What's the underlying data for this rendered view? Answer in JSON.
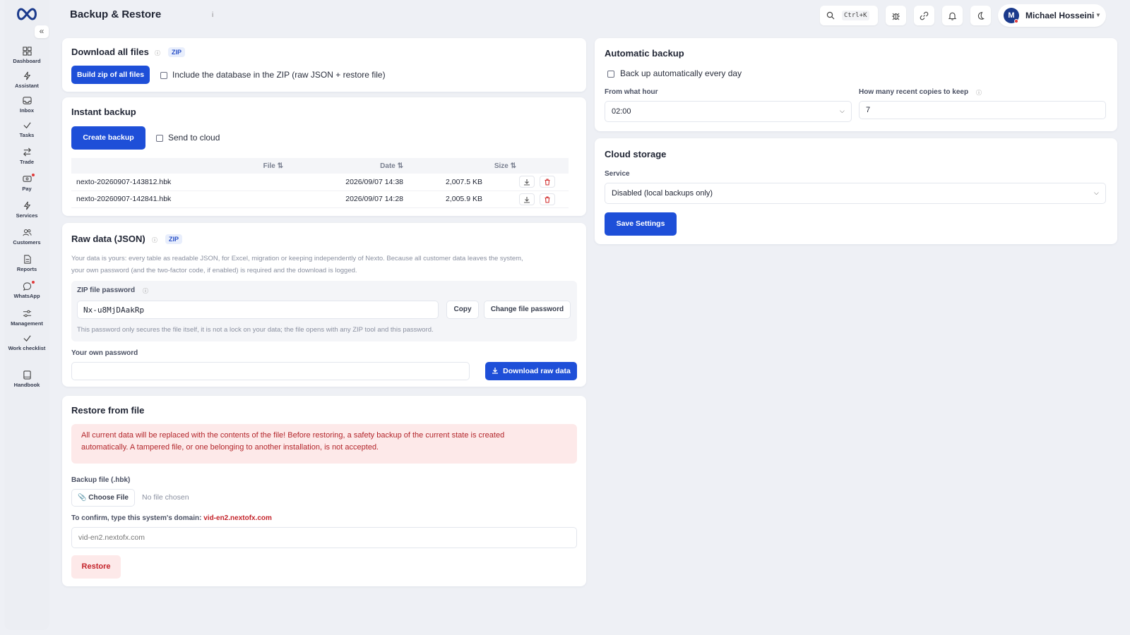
{
  "header": {
    "title": "Backup & Restore",
    "info": "i",
    "search_shortcut": "Ctrl+K",
    "user": {
      "initial": "M",
      "name": "Michael Hosseini"
    }
  },
  "sidebar": {
    "collapse": "«",
    "items": [
      {
        "label": "Dashboard",
        "icon": "grid-icon"
      },
      {
        "label": "Assistant",
        "icon": "bolt-icon"
      },
      {
        "label": "Inbox",
        "icon": "inbox-icon"
      },
      {
        "label": "Tasks",
        "icon": "check-icon"
      },
      {
        "label": "Trade",
        "icon": "swap-icon"
      },
      {
        "label": "Pay",
        "icon": "wallet-icon",
        "dot": true
      },
      {
        "label": "Services",
        "icon": "bolt-icon"
      },
      {
        "label": "Customers",
        "icon": "users-icon"
      },
      {
        "label": "Reports",
        "icon": "document-icon"
      },
      {
        "label": "WhatsApp",
        "icon": "chat-icon",
        "dot": true
      },
      {
        "label": "Management",
        "icon": "sliders-icon"
      },
      {
        "label": "Work checklist",
        "icon": "check-icon"
      },
      {
        "label": "Handbook",
        "icon": "book-icon"
      }
    ]
  },
  "download_all": {
    "title": "Download all files",
    "badge": "ZIP",
    "button": "Build zip of all files",
    "include_db_label": "Include the database in the ZIP (raw JSON + restore file)"
  },
  "instant_backup": {
    "title": "Instant backup",
    "button": "Create backup",
    "send_cloud_label": "Send to cloud",
    "columns": [
      "File ⇅",
      "Date ⇅",
      "Size ⇅"
    ],
    "rows": [
      {
        "file": "nexto-20260907-143812.hbk",
        "date": "2026/09/07 14:38",
        "size": "2,007.5 KB"
      },
      {
        "file": "nexto-20260907-142841.hbk",
        "date": "2026/09/07 14:28",
        "size": "2,005.9 KB"
      }
    ]
  },
  "raw_data": {
    "title": "Raw data (JSON)",
    "badge": "ZIP",
    "description_1": "Your data is yours: every table as readable JSON, for Excel, migration or keeping independently of Nexto. Because all customer data leaves the system,",
    "description_2": "your own password (and the two-factor code, if enabled) is required and the download is logged.",
    "zip_password_label": "ZIP file password",
    "zip_password_value": "Nx-u8MjDAakRp",
    "copy_button": "Copy",
    "change_button": "Change file password",
    "zip_note": "This password only secures the file itself, it is not a lock on your data; the file opens with any ZIP tool and this password.",
    "own_password_label": "Your own password",
    "download_button": "Download raw data"
  },
  "restore": {
    "title": "Restore from file",
    "warning_1": "All current data will be replaced with the contents of the file! Before restoring, a safety backup of the current state is created",
    "warning_2": "automatically. A tampered file, or one belonging to another installation, is not accepted.",
    "file_label": "Backup file (.hbk)",
    "choose_file": "Choose File",
    "no_file": "No file chosen",
    "confirm_label": "To confirm, type this system's domain:",
    "domain": "vid-en2.nextofx.com",
    "domain_placeholder": "vid-en2.nextofx.com",
    "restore_button": "Restore"
  },
  "auto_backup": {
    "title": "Automatic backup",
    "daily_label": "Back up automatically every day",
    "hour_label": "From what hour",
    "hour_value": "02:00",
    "copies_label": "How many recent copies to keep",
    "copies_value": "7"
  },
  "cloud": {
    "title": "Cloud storage",
    "service_label": "Service",
    "service_value": "Disabled (local backups only)",
    "save_button": "Save Settings"
  },
  "colors": {
    "primary": "#1e4fd8",
    "danger": "#b3262b",
    "danger_bg": "#fde9e9",
    "brand": "#1b3a8c"
  }
}
